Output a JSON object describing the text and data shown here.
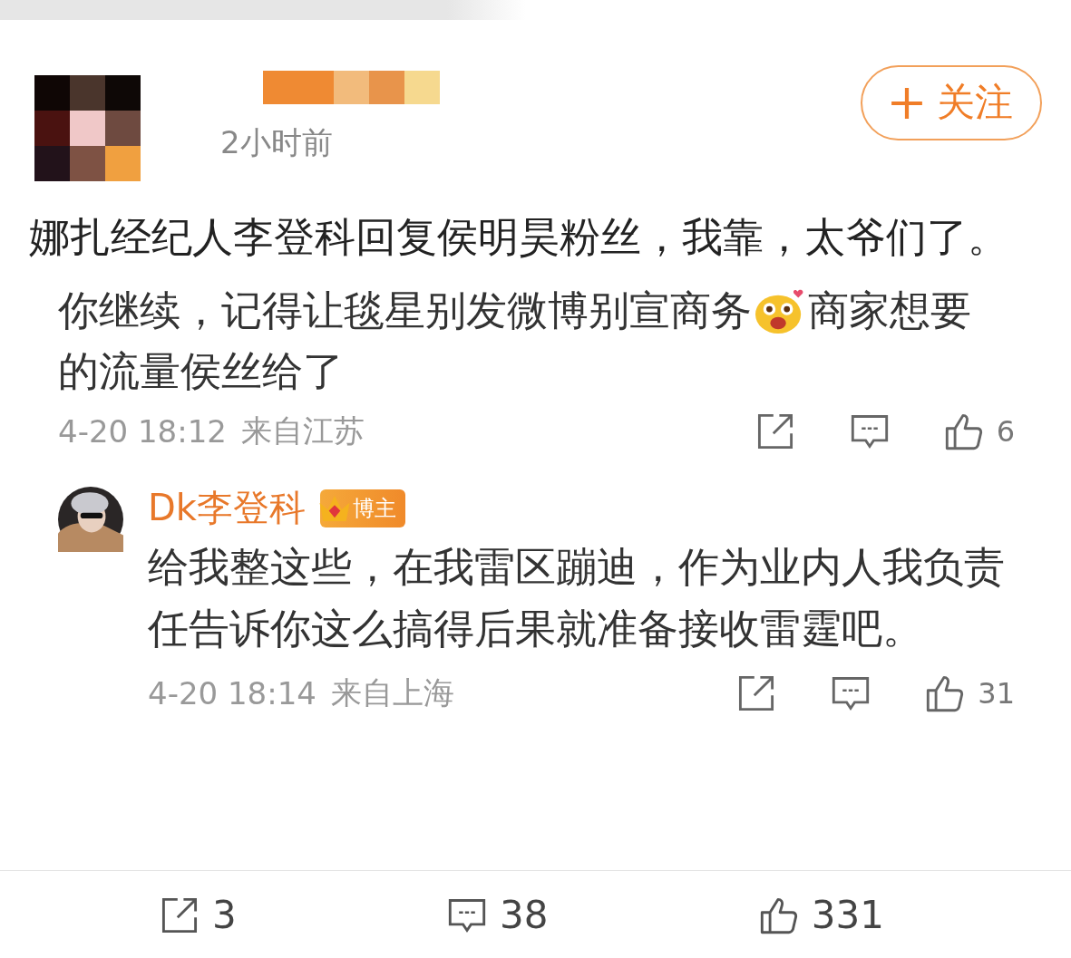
{
  "post": {
    "time": "2小时前",
    "follow_button": "关注",
    "text": "娜扎经纪人李登科回复侯明昊粉丝，我靠，太爷们了。"
  },
  "comment": {
    "text_parts": [
      "你继续，记得让毯星别发微博别宣商务",
      "商家想要",
      "的流量侯丝给了"
    ],
    "date": "4-20 18:12",
    "location": "来自江苏",
    "actions": [
      {
        "kind": "repost"
      },
      {
        "kind": "comment"
      },
      {
        "kind": "like",
        "count": "6"
      }
    ],
    "reply": {
      "author": "Dk李登科",
      "badge": "博主",
      "text": "给我整这些，在我雷区蹦迪，作为业内人我负责任告诉你这么搞得后果就准备接收雷霆吧。",
      "date": "4-20 18:14",
      "location": "来自上海",
      "actions": [
        {
          "kind": "repost"
        },
        {
          "kind": "comment"
        },
        {
          "kind": "like",
          "count": "31"
        }
      ]
    }
  },
  "footer": [
    {
      "kind": "repost",
      "count": "3"
    },
    {
      "kind": "comment",
      "count": "38"
    },
    {
      "kind": "like",
      "count": "331"
    }
  ]
}
